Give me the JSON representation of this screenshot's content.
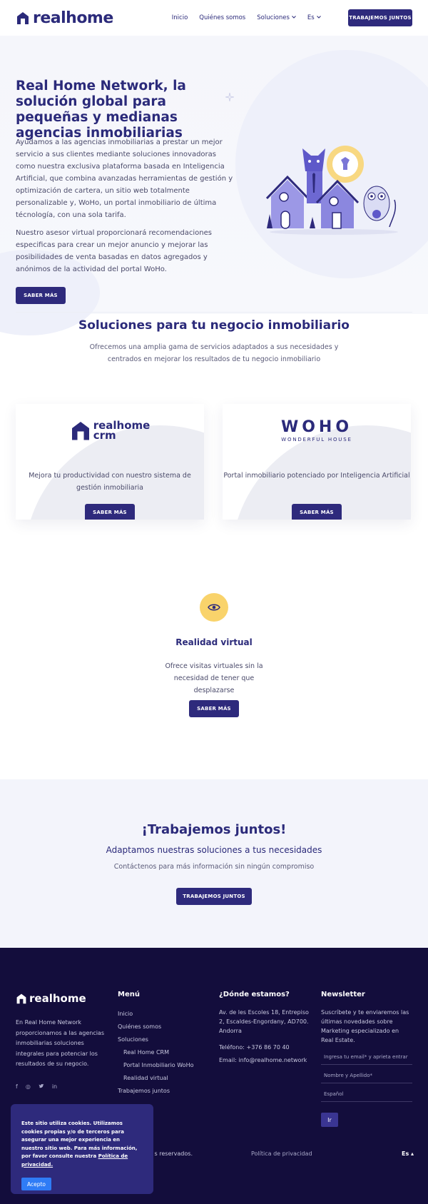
{
  "header": {
    "logo_text": "realhome",
    "nav": [
      {
        "label": "Inicio"
      },
      {
        "label": "Quiénes somos"
      },
      {
        "label": "Soluciones"
      },
      {
        "label": "Es"
      }
    ],
    "cta_label": "TRABAJEMOS JUNTOS"
  },
  "hero": {
    "title": "Real Home Network, la solución global para pequeñas y medianas agencias inmobiliarias",
    "p1": "Ayudamos a las agencias inmobiliarias a prestar un mejor servicio a sus clientes mediante soluciones innovadoras como nuestra exclusiva plataforma basada en Inteligencia Artificial, que combina avanzadas herramientas de gestión y optimización de cartera, un sitio web totalmente personalizable y, WoHo, un portal inmobiliario de última técnología, con una sola tarifa.",
    "p2": "Nuestro asesor virtual proporcionará recomendaciones especificas para crear un mejor anuncio y mejorar las posibilidades de venta basadas en datos agregados y anónimos de la actividad del portal WoHo.",
    "button": "SABER MÁS"
  },
  "solutions": {
    "title": "Soluciones para tu negocio inmobiliario",
    "subtitle": "Ofrecemos una amplia gama de servicios adaptados a sus necesidades y centrados en mejorar los resultados de tu negocio inmobiliario",
    "cards": [
      {
        "logo_line1": "realhome",
        "logo_line2": "crm",
        "text": "Mejora tu productividad con nuestro sistema de gestión inmobiliaria",
        "button": "SABER MÁS"
      },
      {
        "logo_line1": "WOHO",
        "logo_line2": "WONDERFUL HOUSE",
        "text": "Portal inmobiliario potenciado por Inteligencia Artificial",
        "button": "SABER MÁS"
      }
    ],
    "vr": {
      "title": "Realidad virtual",
      "text": "Ofrece visitas virtuales sin la necesidad de tener que desplazarse",
      "button": "SABER MÁS"
    }
  },
  "work": {
    "title": "¡Trabajemos juntos!",
    "subtitle": "Adaptamos nuestras soluciones a tus necesidades",
    "text": "Contáctenos para más información sin ningún compromiso",
    "button": "TRABAJEMOS JUNTOS"
  },
  "footer": {
    "logo_text": "realhome",
    "about": "En Real Home Network proporcionamos a las agencias inmobiliarias soluciones integrales para potenciar los resultados de su negocio.",
    "social": [
      "f",
      "◎",
      "🐦",
      "in"
    ],
    "menu_title": "Menú",
    "menu": [
      "Inicio",
      "Quiénes somos",
      "Soluciones",
      "Real Home CRM",
      "Portal Inmobiliario WoHo",
      "Realidad virtual",
      "Trabajemos juntos"
    ],
    "where_title": "¿Dónde estamos?",
    "address": "Av. de les Escoles 18, Entrepiso 2, Escaldes-Engordany, AD700. Andorra",
    "phone": "Teléfono: +376 86 70 40",
    "email": "Email: info@realhome.network",
    "news_title": "Newsletter",
    "news_text": "Suscríbete y te enviaremos las últimas novedades sobre Marketing especializado en Real Estate.",
    "email_placeholder": "Ingresa tu email* y aprieta entrar",
    "name_placeholder": "Nombre y Apellido*",
    "lang_select": "Español",
    "submit": "Ir",
    "rights": "s reservados.",
    "privacy": "Política de privacidad",
    "lang": "Es ▴"
  },
  "cookie": {
    "text": "Este sitio utiliza cookies. Utilizamos cookies propias y/o de terceros para asegurar una mejor experiencia en nuestro sitio web. Para más información, por favor consulte nuestra",
    "link": "Política de privacidad.",
    "button": "Acepto"
  },
  "colors": {
    "brand": "#2e2a7c",
    "accent_yellow": "#f9d36b",
    "footer_bg": "#130d3c",
    "cookie_button": "#2f7cf6"
  }
}
